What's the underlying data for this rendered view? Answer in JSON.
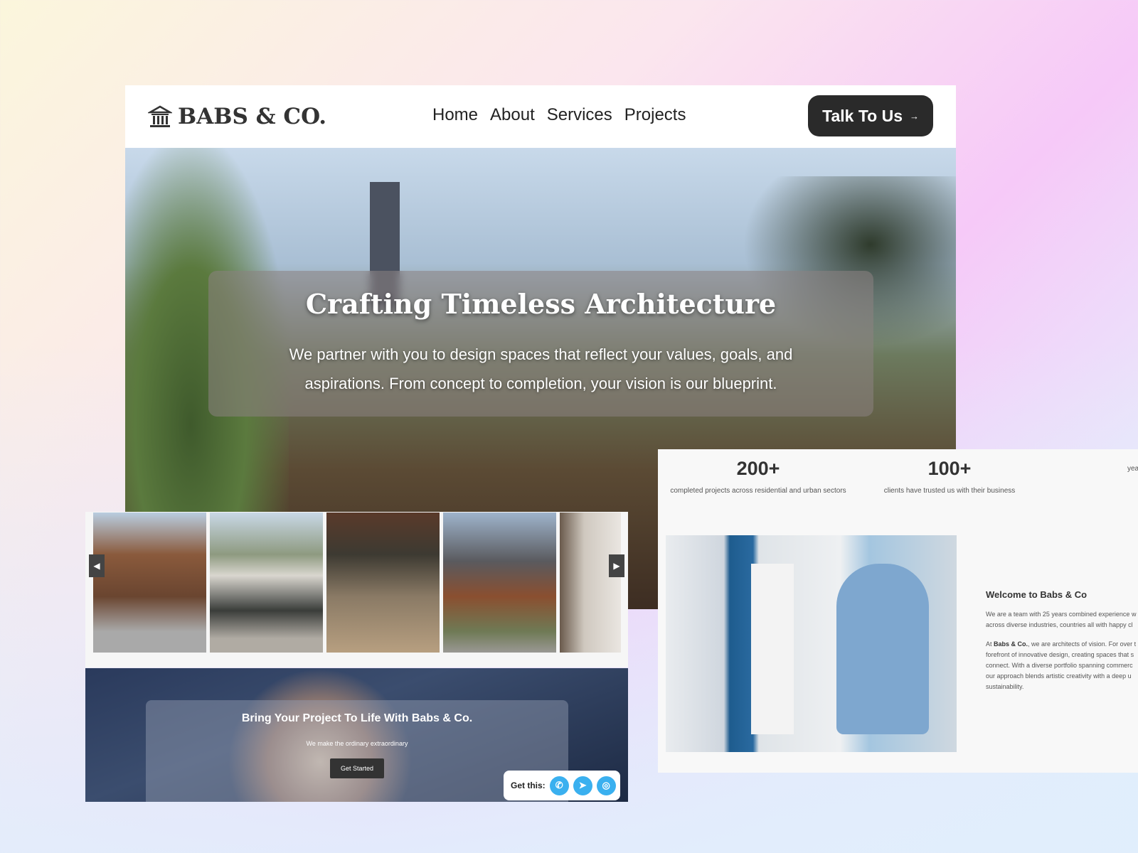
{
  "brand": {
    "name": "BABS & CO.",
    "icon": "bank-building-icon"
  },
  "nav": {
    "items": [
      "Home",
      "About",
      "Services",
      "Projects"
    ],
    "cta": "Talk To Us",
    "cta_icon": "arrow-right-icon"
  },
  "hero": {
    "title": "Crafting Timeless Architecture",
    "subtitle": "We partner with you to design spaces that reflect your values, goals, and aspirations. From concept to completion, your vision is our blueprint."
  },
  "gallery": {
    "prev_icon": "◀",
    "next_icon": "▶"
  },
  "cta": {
    "title": "Bring Your Project To Life With Babs & Co.",
    "subtitle": "We make the ordinary extraordinary",
    "button": "Get Started"
  },
  "share": {
    "label": "Get this:",
    "icons": [
      "whatsapp-icon",
      "telegram-icon",
      "instagram-icon"
    ]
  },
  "stats": [
    {
      "value": "200+",
      "label": "completed projects across residential and urban sectors"
    },
    {
      "value": "100+",
      "label": "clients have trusted us with their business"
    },
    {
      "value": "",
      "label": "yea"
    }
  ],
  "about": {
    "title": "Welcome to Babs & Co",
    "p1": [
      "We are a team with 25 years combined experience w",
      "across diverse industries, countries all with happy cl"
    ],
    "p2_bold": "Babs & Co.",
    "p2_pre": "At ",
    "p2_rest": ", we are architects of vision. For over t",
    "p2_lines": [
      "forefront of innovative design, creating spaces that s",
      "connect. With a diverse portfolio spanning commerc",
      "our approach blends artistic creativity with a deep u",
      "sustainability."
    ]
  },
  "colors": {
    "dark": "#2a2a2a",
    "social": "#3ab0ef"
  }
}
